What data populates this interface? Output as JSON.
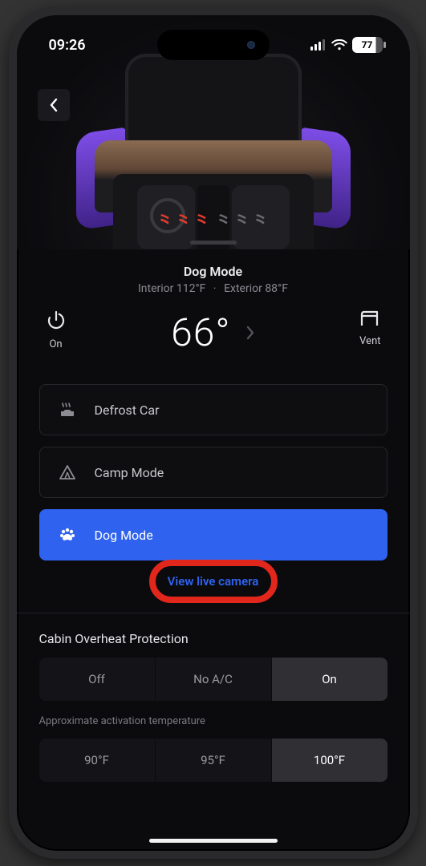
{
  "status": {
    "time": "09:26",
    "battery_percent": "77"
  },
  "header": {
    "mode_name": "Dog Mode",
    "interior_label": "Interior 112°F",
    "exterior_label": "Exterior 88°F"
  },
  "controls": {
    "power_label": "On",
    "temperature": "66°",
    "vent_label": "Vent"
  },
  "modes": {
    "defrost": "Defrost Car",
    "camp": "Camp Mode",
    "dog": "Dog Mode"
  },
  "live_camera_link": "View live camera",
  "overheat": {
    "title": "Cabin Overheat Protection",
    "options": {
      "off": "Off",
      "noac": "No A/C",
      "on": "On"
    },
    "selected": "on",
    "temp_sublabel": "Approximate activation temperature",
    "temps": {
      "t90": "90°F",
      "t95": "95°F",
      "t100": "100°F"
    },
    "temp_selected": "t100"
  },
  "annotations": {
    "highlight": "live_camera_link"
  }
}
